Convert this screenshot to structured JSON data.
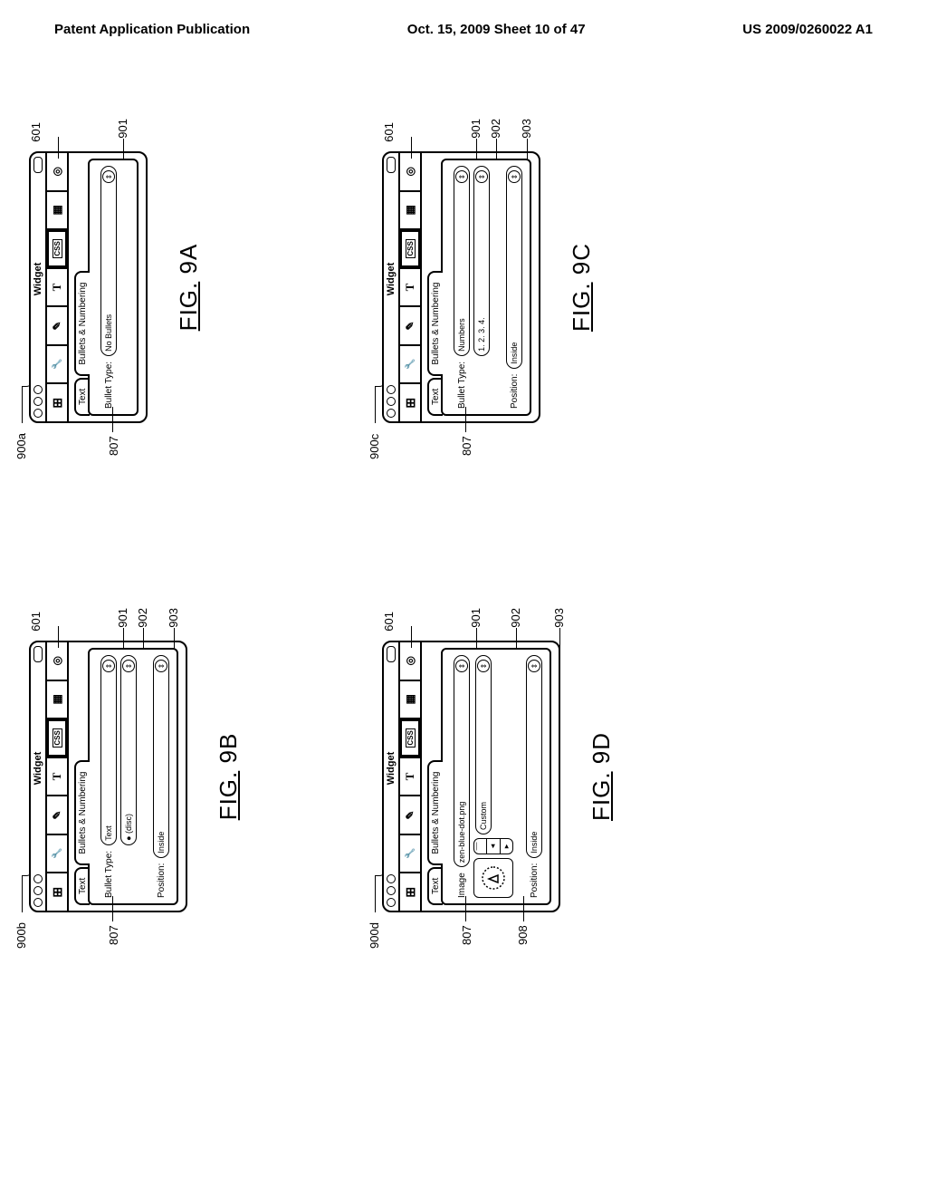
{
  "header": {
    "left": "Patent Application Publication",
    "center": "Oct. 15, 2009  Sheet 10 of 47",
    "right": "US 2009/0260022 A1"
  },
  "common": {
    "window_title": "Widget",
    "tab_text": "Text",
    "tab_bullets": "Bullets & Numbering",
    "bullet_type_label": "Bullet Type:",
    "position_label": "Position:",
    "image_label": "Image",
    "position_value": "Inside",
    "ref_807": "807",
    "ref_601": "601",
    "ref_900a": "900a",
    "ref_900b": "900b",
    "ref_900c": "900c",
    "ref_900d": "900d",
    "ref_901": "901",
    "ref_902": "902",
    "ref_903": "903",
    "ref_908": "908"
  },
  "panels": {
    "a": {
      "figlabel": "FIG. 9A",
      "combo1": "No Bullets"
    },
    "b": {
      "figlabel": "FIG. 9B",
      "combo1": "Text",
      "combo2": "● (disc)"
    },
    "c": {
      "figlabel": "FIG. 9C",
      "combo1": "Numbers",
      "combo2": "1. 2. 3. 4."
    },
    "d": {
      "figlabel": "FIG. 9D",
      "img_name": "zen-blue-dot.png",
      "combo2": "Custom"
    }
  }
}
